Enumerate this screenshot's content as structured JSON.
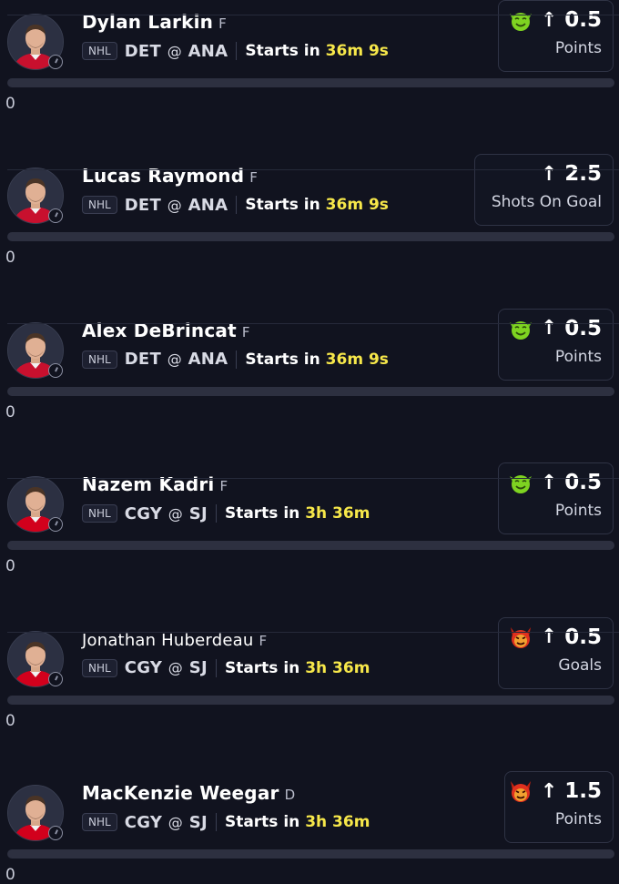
{
  "players": [
    {
      "name": "Dylan Larkin",
      "position": "F",
      "league": "NHL",
      "away": "DET",
      "at": "@",
      "home": "ANA",
      "starts_label": "Starts in",
      "starts_time": "36m 9s",
      "line_value": "0.5",
      "stat": "Points",
      "badge": "goblin-icon",
      "count": "0",
      "jersey_color": "#c8102e"
    },
    {
      "name": "Lucas Raymond",
      "position": "F",
      "league": "NHL",
      "away": "DET",
      "at": "@",
      "home": "ANA",
      "starts_label": "Starts in",
      "starts_time": "36m 9s",
      "line_value": "2.5",
      "stat": "Shots On Goal",
      "badge": "",
      "count": "0",
      "jersey_color": "#c8102e"
    },
    {
      "name": "Alex DeBrincat",
      "position": "F",
      "league": "NHL",
      "away": "DET",
      "at": "@",
      "home": "ANA",
      "starts_label": "Starts in",
      "starts_time": "36m 9s",
      "line_value": "0.5",
      "stat": "Points",
      "badge": "goblin-icon",
      "count": "0",
      "jersey_color": "#c8102e"
    },
    {
      "name": "Nazem Kadri",
      "position": "F",
      "league": "NHL",
      "away": "CGY",
      "at": "@",
      "home": "SJ",
      "starts_label": "Starts in",
      "starts_time": "3h 36m",
      "line_value": "0.5",
      "stat": "Points",
      "badge": "goblin-icon",
      "count": "0",
      "jersey_color": "#d2001c"
    },
    {
      "name": "Jonathan Huberdeau",
      "position": "F",
      "league": "NHL",
      "away": "CGY",
      "at": "@",
      "home": "SJ",
      "starts_label": "Starts in",
      "starts_time": "3h 36m",
      "line_value": "0.5",
      "stat": "Goals",
      "badge": "demon-icon",
      "count": "0",
      "jersey_color": "#d2001c"
    },
    {
      "name": "MacKenzie Weegar",
      "position": "D",
      "league": "NHL",
      "away": "CGY",
      "at": "@",
      "home": "SJ",
      "starts_label": "Starts in",
      "starts_time": "3h 36m",
      "line_value": "1.5",
      "stat": "Points",
      "badge": "demon-icon",
      "count": "0",
      "jersey_color": "#d2001c"
    }
  ],
  "colors": {
    "background": "#11131f",
    "accent_time": "#f7e84a",
    "goblin": "#7ed321",
    "demon": "#e0301e"
  }
}
